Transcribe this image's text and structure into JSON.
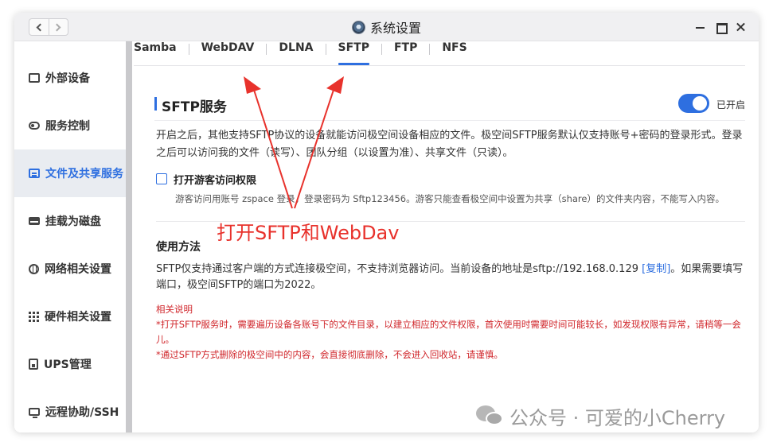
{
  "window": {
    "title": "系统设置"
  },
  "sidebar": {
    "items": [
      {
        "label": "外部设备",
        "icon": "external-device-icon"
      },
      {
        "label": "服务控制",
        "icon": "toggle-icon"
      },
      {
        "label": "文件及共享服务",
        "icon": "file-share-icon",
        "active": true
      },
      {
        "label": "挂载为磁盘",
        "icon": "disk-icon"
      },
      {
        "label": "网络相关设置",
        "icon": "globe-icon"
      },
      {
        "label": "硬件相关设置",
        "icon": "grid-icon"
      },
      {
        "label": "UPS管理",
        "icon": "ups-icon"
      },
      {
        "label": "远程协助/SSH",
        "icon": "monitor-icon"
      }
    ]
  },
  "tabs": [
    "Samba",
    "WebDAV",
    "DLNA",
    "SFTP",
    "FTP",
    "NFS"
  ],
  "active_tab": "SFTP",
  "sftp": {
    "title": "SFTP服务",
    "toggle_label": "已开启",
    "toggle_on": true,
    "description": "开启之后，其他支持SFTP协议的设备就能访问极空间设备相应的文件。极空间SFTP服务默认仅支持账号+密码的登录形式。登录之后可以访问我的文件（读写）、团队分组（以设置为准）、共享文件（只读）。",
    "guest_checkbox_label": "打开游客访问权限",
    "guest_checked": false,
    "guest_hint": "游客访问用账号 zspace 登录，登录密码为 Sftp123456。游客只能查看极空间中设置为共享（share）的文件夹内容，不能写入内容。"
  },
  "annotation": "打开SFTP和WebDav",
  "usage": {
    "title": "使用方法",
    "text_before": "SFTP仅支持通过客户端的方式连接极空间，不支持浏览器访问。当前设备的地址是sftp://192.168.0.129 ",
    "copy_link": "[复制]",
    "text_after": "。如果需要填写端口，极空间SFTP的端口为2022。"
  },
  "notes": {
    "title": "相关说明",
    "lines": [
      "*打开SFTP服务时，需要遍历设备各账号下的文件目录，以建立相应的文件权限，首次使用时需要时间可能较长，如发现权限有异常，请稍等一会儿。",
      "*通过SFTP方式删除的极空间中的内容，会直接彻底删除，不会进入回收站，请谨慎。"
    ]
  },
  "watermark": "公众号 · 可爱的小Cherry",
  "colors": {
    "accent": "#2e6fe0",
    "annotation": "#e8322c",
    "notes": "#d0262b"
  }
}
